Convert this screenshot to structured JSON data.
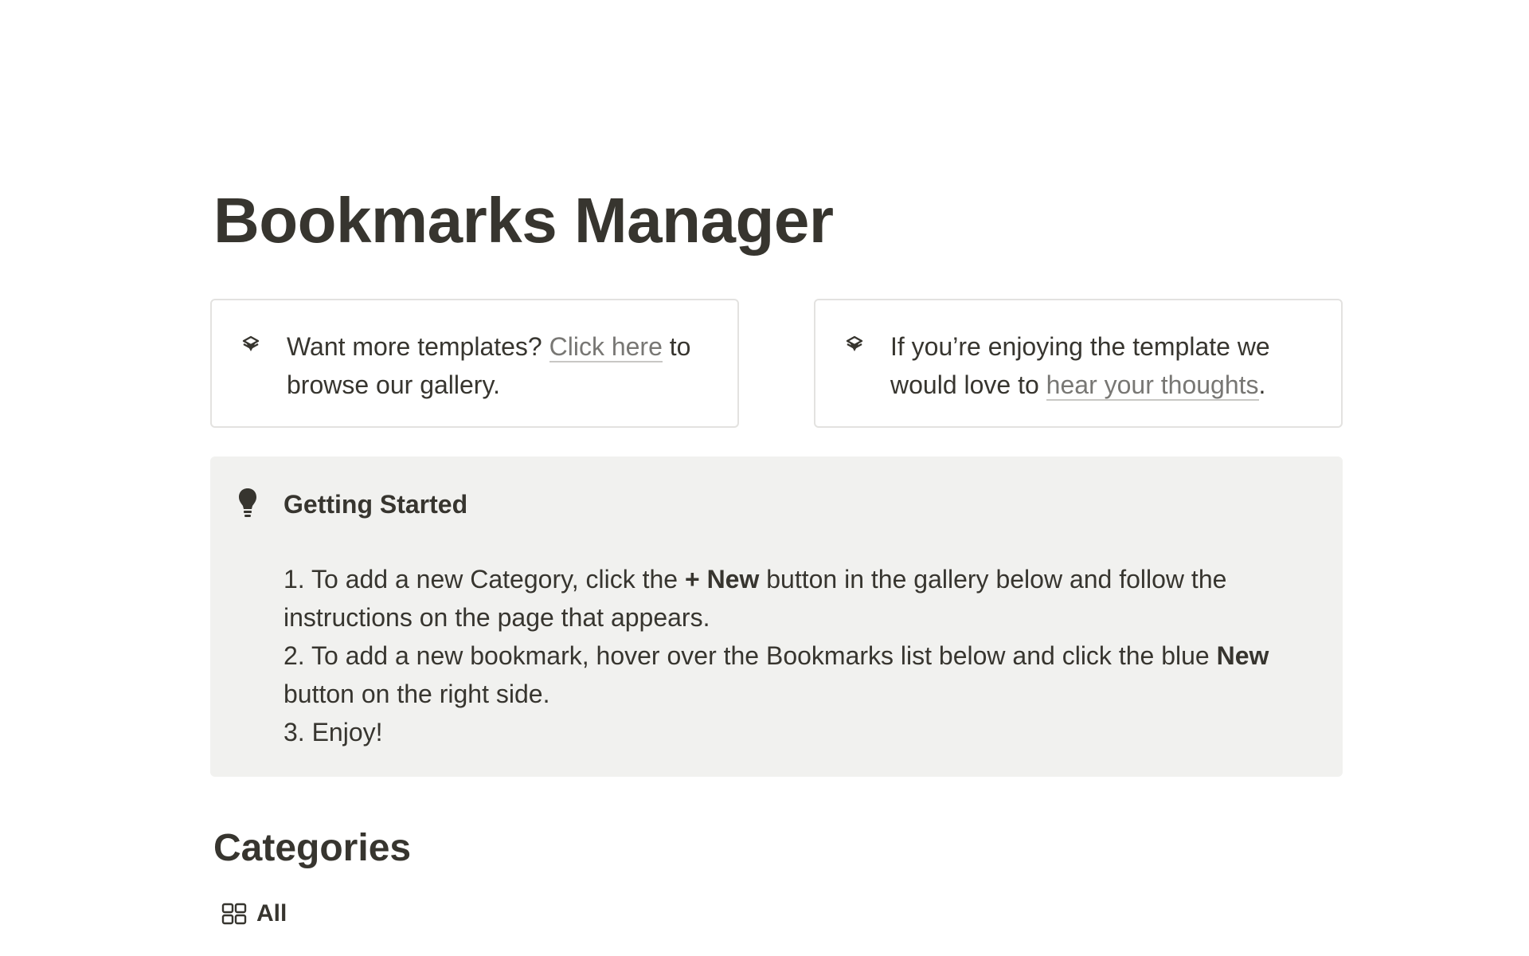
{
  "page": {
    "title": "Bookmarks Manager"
  },
  "callouts": [
    {
      "icon": "notion-logo-icon",
      "text_before": "Want more templates?",
      "link_text": "Click here",
      "text_after": "to browse our gallery."
    },
    {
      "icon": "notion-logo-icon",
      "text_before": "If you’re enjoying the template we would love to",
      "link_text": "hear your thoughts",
      "text_after": "."
    }
  ],
  "getting_started": {
    "icon": "lightbulb-icon",
    "title": "Getting Started",
    "steps": [
      {
        "before": "1. To add a new Category, click the ",
        "bold": "+ New",
        "after": " button in the gallery below and follow the instructions on the page that appears."
      },
      {
        "before": "2. To add a new bookmark, hover over the Bookmarks list below and click the blue ",
        "bold": "New",
        "after": " button on the right side."
      },
      {
        "before": "3. Enjoy!",
        "bold": "",
        "after": ""
      }
    ]
  },
  "categories": {
    "heading": "Categories",
    "view_tab": {
      "icon": "gallery-view-icon",
      "label": "All"
    }
  },
  "colors": {
    "text": "#37352f",
    "link": "#787774",
    "callout_background": "#f1f1ef",
    "card_border": "#e3e2e0"
  }
}
